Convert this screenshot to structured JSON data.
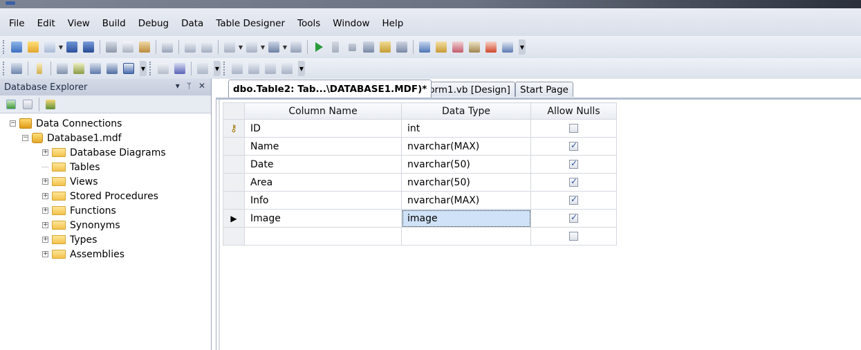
{
  "menu": [
    "File",
    "Edit",
    "View",
    "Build",
    "Debug",
    "Data",
    "Table Designer",
    "Tools",
    "Window",
    "Help"
  ],
  "explorer": {
    "title": "Database Explorer",
    "pin": "ᛘ",
    "close": "✕",
    "root": "Data Connections",
    "database": "Database1.mdf",
    "items": [
      {
        "label": "Database Diagrams",
        "expandable": true
      },
      {
        "label": "Tables",
        "expandable": false
      },
      {
        "label": "Views",
        "expandable": true
      },
      {
        "label": "Stored Procedures",
        "expandable": true
      },
      {
        "label": "Functions",
        "expandable": true
      },
      {
        "label": "Synonyms",
        "expandable": true
      },
      {
        "label": "Types",
        "expandable": true
      },
      {
        "label": "Assemblies",
        "expandable": true
      }
    ]
  },
  "tabs": [
    {
      "label": "dbo.Table2: Tab...\\DATABASE1.MDF)*",
      "active": true
    },
    {
      "label": "Form1.vb [Design]",
      "active": false
    },
    {
      "label": "Start Page",
      "active": false
    }
  ],
  "grid": {
    "headers": [
      "Column Name",
      "Data Type",
      "Allow Nulls"
    ],
    "rows": [
      {
        "marker": "key",
        "name": "ID",
        "type": "int",
        "nulls": false
      },
      {
        "marker": "",
        "name": "Name",
        "type": "nvarchar(MAX)",
        "nulls": true
      },
      {
        "marker": "",
        "name": "Date",
        "type": "nvarchar(50)",
        "nulls": true
      },
      {
        "marker": "",
        "name": "Area",
        "type": "nvarchar(50)",
        "nulls": true
      },
      {
        "marker": "",
        "name": "Info",
        "type": "nvarchar(MAX)",
        "nulls": true
      },
      {
        "marker": "current",
        "name": "Image",
        "type": "image",
        "nulls": true
      },
      {
        "marker": "",
        "name": "",
        "type": "",
        "nulls": false
      }
    ],
    "editing_row": 5
  },
  "colors": {
    "selection": "#cfe2f7",
    "chrome": "#d9dfea"
  }
}
